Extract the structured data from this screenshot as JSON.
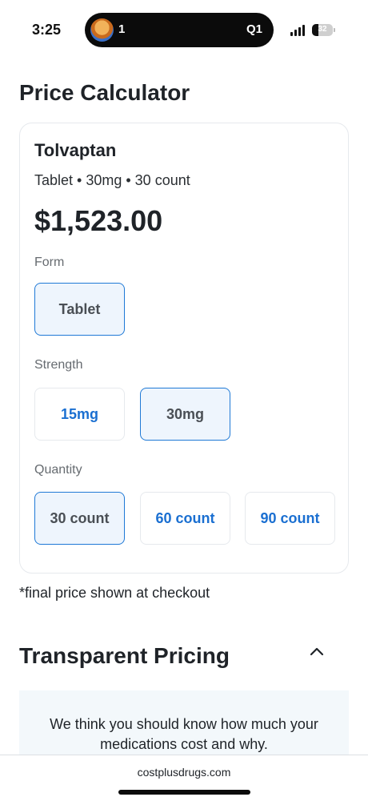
{
  "status_bar": {
    "time": "3:25",
    "island_left": "1",
    "island_right": "Q1",
    "battery_level": "32"
  },
  "page_title": "Price Calculator",
  "card": {
    "drug_name": "Tolvaptan",
    "subtitle": "Tablet • 30mg • 30 count",
    "price": "$1,523.00",
    "form": {
      "label": "Form",
      "options": [
        {
          "label": "Tablet",
          "selected": true
        }
      ]
    },
    "strength": {
      "label": "Strength",
      "options": [
        {
          "label": "15mg",
          "selected": false
        },
        {
          "label": "30mg",
          "selected": true
        }
      ]
    },
    "quantity": {
      "label": "Quantity",
      "options": [
        {
          "label": "30 count",
          "selected": true
        },
        {
          "label": "60 count",
          "selected": false
        },
        {
          "label": "90 count",
          "selected": false
        }
      ]
    }
  },
  "note": "*final price shown at checkout",
  "transparent_pricing": {
    "title": "Transparent Pricing",
    "chevron_icon": "chevron-up-icon",
    "body": "We think you should know how much your medications cost and why."
  },
  "browser": {
    "url": "costplusdrugs.com"
  },
  "colors": {
    "accent": "#1a6fd1",
    "selected_border": "#1f79d6",
    "selected_bg": "#eef5fd",
    "info_bg": "#f3f8fb"
  }
}
